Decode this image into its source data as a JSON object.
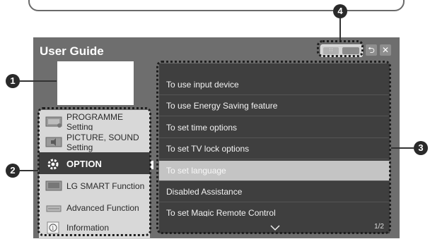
{
  "window": {
    "title": "User Guide"
  },
  "callouts": [
    "1",
    "2",
    "3",
    "4"
  ],
  "title_buttons": {
    "back": "⮌",
    "close": "✕"
  },
  "view_toggle": {
    "grid_glyph": "∷"
  },
  "sidebar": {
    "items": [
      {
        "label": "PROGRAMME Setting",
        "icon": "tv-settings-icon"
      },
      {
        "label": "PICTURE, SOUND Setting",
        "icon": "picture-sound-icon"
      },
      {
        "label": "OPTION",
        "icon": "gear-icon",
        "active": true
      },
      {
        "label": "LG SMART Function",
        "icon": "smart-tv-icon"
      },
      {
        "label": "Advanced Function",
        "icon": "advanced-icon"
      },
      {
        "label": "Information",
        "icon": "info-icon"
      }
    ]
  },
  "content": {
    "items": [
      {
        "label": "To use input device"
      },
      {
        "label": "To use Energy Saving feature"
      },
      {
        "label": "To set time options"
      },
      {
        "label": "To set TV lock options"
      },
      {
        "label": "To set language",
        "selected": true
      },
      {
        "label": "Disabled Assistance"
      },
      {
        "label": "To set Magic Remote Control"
      }
    ],
    "page_indicator": "1/2"
  },
  "colors": {
    "panel": "#6e6e6e",
    "sidebar": "#dcdcdc",
    "active_item": "#3e3e3e",
    "content_bg": "#3f3f3f",
    "selected_row": "#c4c4c4"
  }
}
